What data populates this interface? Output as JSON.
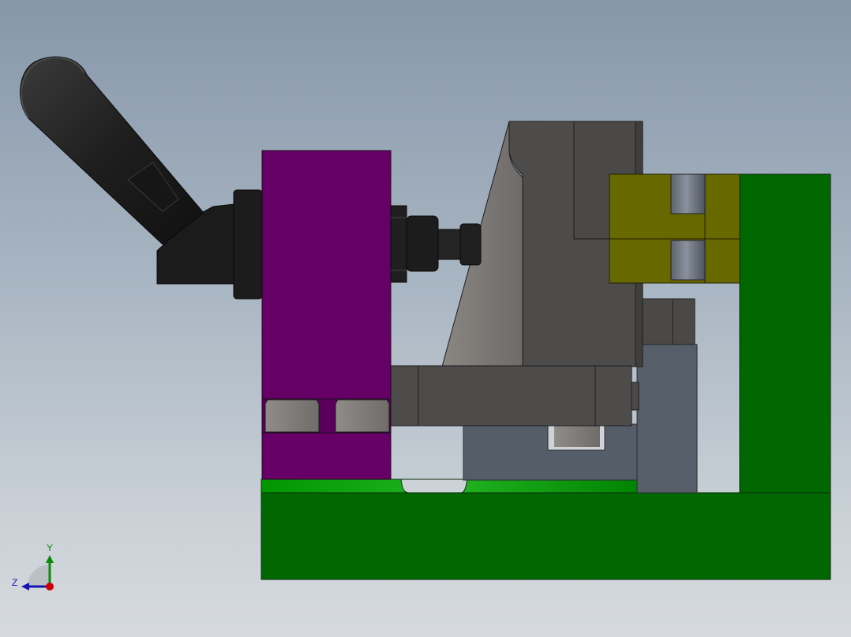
{
  "viewport": {
    "background_top": "#8797aa",
    "background_bottom": "#d6dade"
  },
  "parts": {
    "base_color": "#016701",
    "clamp_block_color": "#660066",
    "side_block_color": "#686800",
    "handle_color": "#1b1b1b",
    "steel_dark_color": "#4a4948",
    "steel_light_color": "#7e7a76",
    "slate_color": "#565e69"
  },
  "axis_triad": {
    "y_label": "Y",
    "z_label": "Z",
    "y_color": "#0a8a0a",
    "z_color": "#1515b5",
    "origin_color": "#cc0000"
  }
}
